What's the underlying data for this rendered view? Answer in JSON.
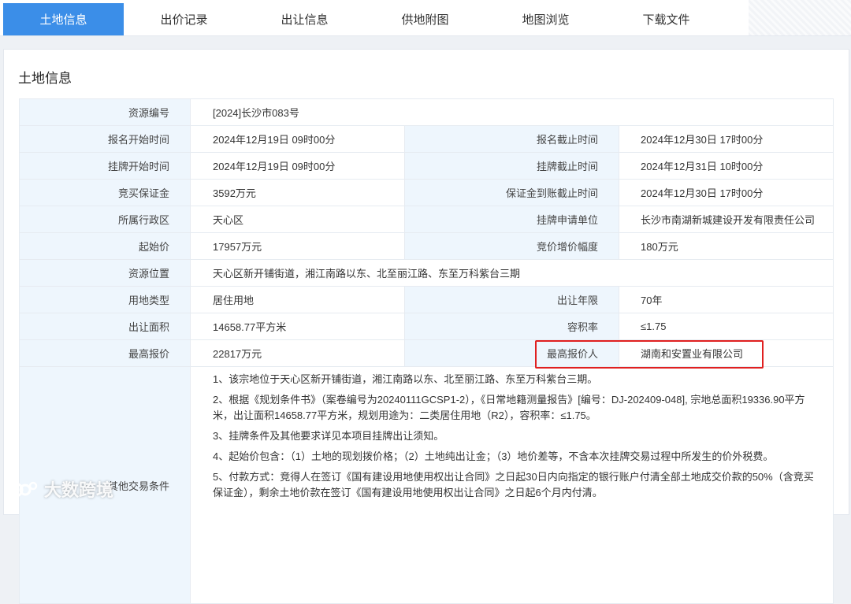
{
  "tabs": [
    {
      "label": "土地信息",
      "active": true
    },
    {
      "label": "出价记录",
      "active": false
    },
    {
      "label": "出让信息",
      "active": false
    },
    {
      "label": "供地附图",
      "active": false
    },
    {
      "label": "地图浏览",
      "active": false
    },
    {
      "label": "下载文件",
      "active": false
    }
  ],
  "section_title": "土地信息",
  "rows": {
    "resource_no": {
      "label": "资源编号",
      "value": "[2024]长沙市083号"
    },
    "reg_start": {
      "label": "报名开始时间",
      "value": "2024年12月19日 09时00分"
    },
    "reg_end": {
      "label": "报名截止时间",
      "value": "2024年12月30日 17时00分"
    },
    "list_start": {
      "label": "挂牌开始时间",
      "value": "2024年12月19日 09时00分"
    },
    "list_end": {
      "label": "挂牌截止时间",
      "value": "2024年12月31日 10时00分"
    },
    "deposit": {
      "label": "竞买保证金",
      "value": "3592万元"
    },
    "deposit_deadline": {
      "label": "保证金到账截止时间",
      "value": "2024年12月30日 17时00分"
    },
    "district": {
      "label": "所属行政区",
      "value": "天心区"
    },
    "applicant": {
      "label": "挂牌申请单位",
      "value": "长沙市南湖新城建设开发有限责任公司"
    },
    "start_price": {
      "label": "起始价",
      "value": "17957万元"
    },
    "increment": {
      "label": "竞价增价幅度",
      "value": "180万元"
    },
    "location": {
      "label": "资源位置",
      "value": "天心区新开铺街道，湘江南路以东、北至丽江路、东至万科紫台三期"
    },
    "land_use": {
      "label": "用地类型",
      "value": "居住用地"
    },
    "term": {
      "label": "出让年限",
      "value": "70年"
    },
    "area": {
      "label": "出让面积",
      "value": "14658.77平方米"
    },
    "far": {
      "label": "容积率",
      "value": "≤1.75"
    },
    "top_price": {
      "label": "最高报价",
      "value": "22817万元"
    },
    "top_bidder": {
      "label": "最高报价人",
      "value": "湖南和安置业有限公司"
    },
    "conditions": {
      "label": "其他交易条件",
      "items": [
        "1、该宗地位于天心区新开铺街道，湘江南路以东、北至丽江路、东至万科紫台三期。",
        "2、根据《规划条件书》（案卷编号为20240111GCSP1-2），《日常地籍测量报告》[编号：DJ-202409-048], 宗地总面积19336.90平方米，出让面积14658.77平方米，规划用途为：二类居住用地（R2），容积率：≤1.75。",
        "3、挂牌条件及其他要求详见本项目挂牌出让须知。",
        "4、起始价包含：（1）土地的现划拨价格；（2）土地纯出让金；（3）地价差等，不含本次挂牌交易过程中所发生的价外税费。",
        "5、付款方式：竞得人在签订《国有建设用地使用权出让合同》之日起30日内向指定的银行账户付清全部土地成交价款的50%（含竞买保证金），剩余土地价款在签订《国有建设用地使用权出让合同》之日起6个月内付清。"
      ]
    }
  },
  "watermark": "大数跨境",
  "colors": {
    "accent": "#3b8ee8",
    "label_bg": "#eef6fd",
    "highlight": "#e02020"
  }
}
